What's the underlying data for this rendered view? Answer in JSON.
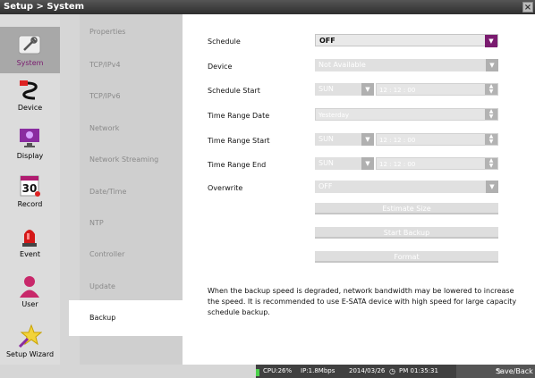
{
  "titlebar": {
    "breadcrumb": "Setup > System",
    "close_glyph": "×"
  },
  "sidebar": {
    "items": [
      {
        "label": "System",
        "icon": "wrench-icon",
        "active": true
      },
      {
        "label": "Device",
        "icon": "cable-icon",
        "active": false
      },
      {
        "label": "Display",
        "icon": "monitor-icon",
        "active": false
      },
      {
        "label": "Record",
        "icon": "calendar-icon",
        "active": false,
        "icon_text": "30"
      },
      {
        "label": "Event",
        "icon": "alarm-light-icon",
        "active": false
      },
      {
        "label": "User",
        "icon": "user-icon",
        "active": false
      },
      {
        "label": "Setup Wizard",
        "icon": "star-wand-icon",
        "active": false
      }
    ]
  },
  "submenu": {
    "items": [
      {
        "label": "Properties"
      },
      {
        "label": "TCP/IPv4"
      },
      {
        "label": "TCP/IPv6"
      },
      {
        "label": "Network"
      },
      {
        "label": "Network Streaming"
      },
      {
        "label": "Date/Time"
      },
      {
        "label": "NTP"
      },
      {
        "label": "Controller"
      },
      {
        "label": "Update"
      },
      {
        "label": "Backup",
        "active": true
      }
    ]
  },
  "form": {
    "schedule": {
      "label": "Schedule",
      "value": "OFF"
    },
    "device": {
      "label": "Device",
      "value": "Not Available"
    },
    "schedule_start": {
      "label": "Schedule Start",
      "day": "SUN",
      "time": "12 : 12 : 00"
    },
    "time_range_date": {
      "label": "Time Range Date",
      "value": "Yesterday"
    },
    "time_range_start": {
      "label": "Time Range Start",
      "day": "SUN",
      "time": "12 : 12 : 00"
    },
    "time_range_end": {
      "label": "Time Range End",
      "day": "SUN",
      "time": "12 : 12 : 00"
    },
    "overwrite": {
      "label": "Overwrite",
      "value": "OFF"
    }
  },
  "buttons": {
    "estimate": "Estimate Size",
    "start_backup": "Start Backup",
    "format": "Format"
  },
  "description": "When the backup speed is degraded, network bandwidth may be lowered to increase the speed. It is recommended to use E-SATA device with high speed for large capacity schedule backup.",
  "statusbar": {
    "cpu": "CPU:26%",
    "ip": "IP:1.8Mbps",
    "date": "2014/03/26",
    "time": "PM 01:35:31",
    "save_back": "Save/Back"
  },
  "colors": {
    "accent": "#7a1b6f",
    "status_green": "#4cd24c"
  }
}
